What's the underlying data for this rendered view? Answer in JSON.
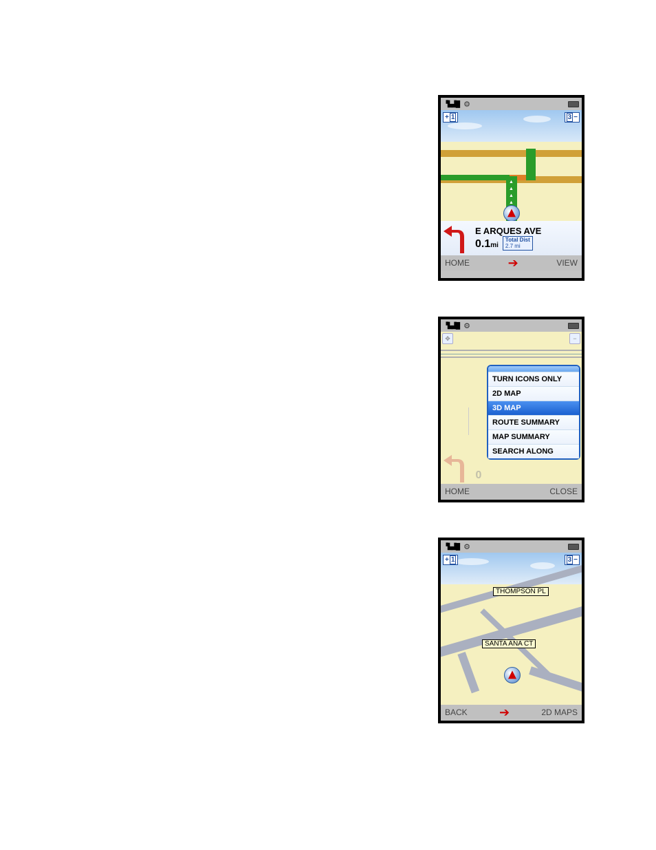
{
  "screen1": {
    "status": {
      "signal_icon": "signal-bars",
      "settings_icon": "gear-icon",
      "battery_icon": "battery-icon"
    },
    "zoom": {
      "plus": "+",
      "plus_num": "1",
      "minus": "−",
      "minus_num": "3"
    },
    "turn": {
      "street": "E ARQUES AVE",
      "distance_value": "0.1",
      "distance_unit": "mi",
      "total_label": "Total Dist",
      "total_value": "2.7 mi"
    },
    "softkeys": {
      "left": "HOME",
      "right": "VIEW"
    }
  },
  "screen2": {
    "status": {
      "signal_icon": "signal-bars",
      "settings_icon": "gear-icon",
      "battery_icon": "battery-icon"
    },
    "view_menu": {
      "items": [
        {
          "label": "TURN ICONS ONLY",
          "selected": false
        },
        {
          "label": "2D MAP",
          "selected": false
        },
        {
          "label": "3D MAP",
          "selected": true
        },
        {
          "label": "ROUTE SUMMARY",
          "selected": false
        },
        {
          "label": "MAP SUMMARY",
          "selected": false
        },
        {
          "label": "SEARCH ALONG",
          "selected": false
        }
      ]
    },
    "faded_distance": "0",
    "softkeys": {
      "left": "HOME",
      "right": "CLOSE"
    }
  },
  "screen3": {
    "status": {
      "signal_icon": "signal-bars",
      "settings_icon": "gear-icon",
      "battery_icon": "battery-icon"
    },
    "zoom": {
      "plus": "+",
      "plus_num": "1",
      "minus": "−",
      "minus_num": "3"
    },
    "street_labels": {
      "label1": "THOMPSON PL",
      "label2": "SANTA ANA CT"
    },
    "softkeys": {
      "left": "BACK",
      "right": "2D MAPS"
    }
  }
}
